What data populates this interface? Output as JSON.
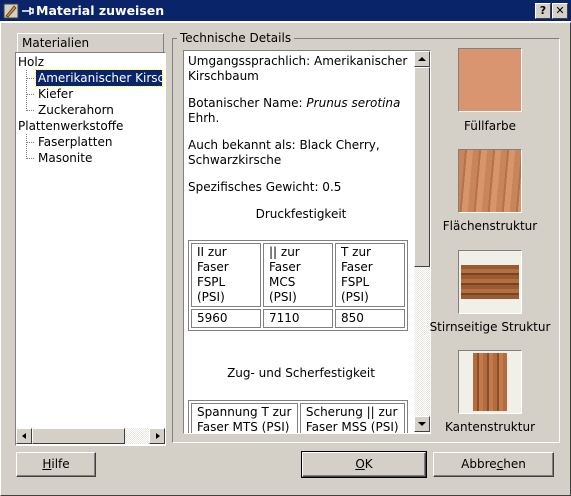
{
  "window": {
    "title": "Material zuweisen",
    "help_glyph": "?",
    "close_glyph": "✕"
  },
  "tree": {
    "header": "Materialien",
    "groups": [
      {
        "label": "Holz",
        "items": [
          "Amerikanischer Kirsch",
          "Kiefer",
          "Zuckerahorn"
        ]
      },
      {
        "label": "Plattenwerkstoffe",
        "items": [
          "Faserplatten",
          "Masonite"
        ]
      }
    ],
    "selected": "Amerikanischer Kirsch"
  },
  "details": {
    "group_label": "Technische Details",
    "common_name": "Umgangssprachlich: Amerikanischer Kirschbaum",
    "botanical_prefix": "Botanischer Name: ",
    "botanical_italic": "Prunus serotina",
    "botanical_suffix": " Ehrh.",
    "aka": "Auch bekannt als: Black Cherry, Schwarzkirsche",
    "gravity": "Spezifisches Gewicht: 0.5",
    "compression_heading": "Druckfestigkeit",
    "compression_table": {
      "headers": [
        [
          "II zur",
          "Faser",
          "FSPL",
          "(PSI)"
        ],
        [
          "|| zur",
          "Faser",
          "MCS",
          "(PSI)"
        ],
        [
          "T zur",
          "Faser",
          "FSPL",
          "(PSI)"
        ]
      ],
      "values": [
        "5960",
        "7110",
        "850"
      ]
    },
    "shear_heading": "Zug- und Scherfestigkeit",
    "shear_table": {
      "headers": [
        [
          "Spannung T zur",
          "Faser MTS (PSI)"
        ],
        [
          "Scherung || zur",
          "Faser MSS (PSI)"
        ]
      ]
    }
  },
  "swatches": [
    {
      "label": "Füllfarbe",
      "color": "#d99470"
    },
    {
      "label": "Flächenstruktur",
      "color": "#c8845a"
    },
    {
      "label": "Stirnseitige Struktur",
      "color": "#9a5a34"
    },
    {
      "label": "Kantenstruktur",
      "color": "#b46c3e"
    }
  ],
  "buttons": {
    "help": {
      "mnemonic": "H",
      "rest": "ilfe"
    },
    "ok": {
      "mnemonic": "O",
      "rest": "K"
    },
    "cancel": {
      "pre": "Abbre",
      "mnemonic": "c",
      "rest": "hen"
    }
  }
}
